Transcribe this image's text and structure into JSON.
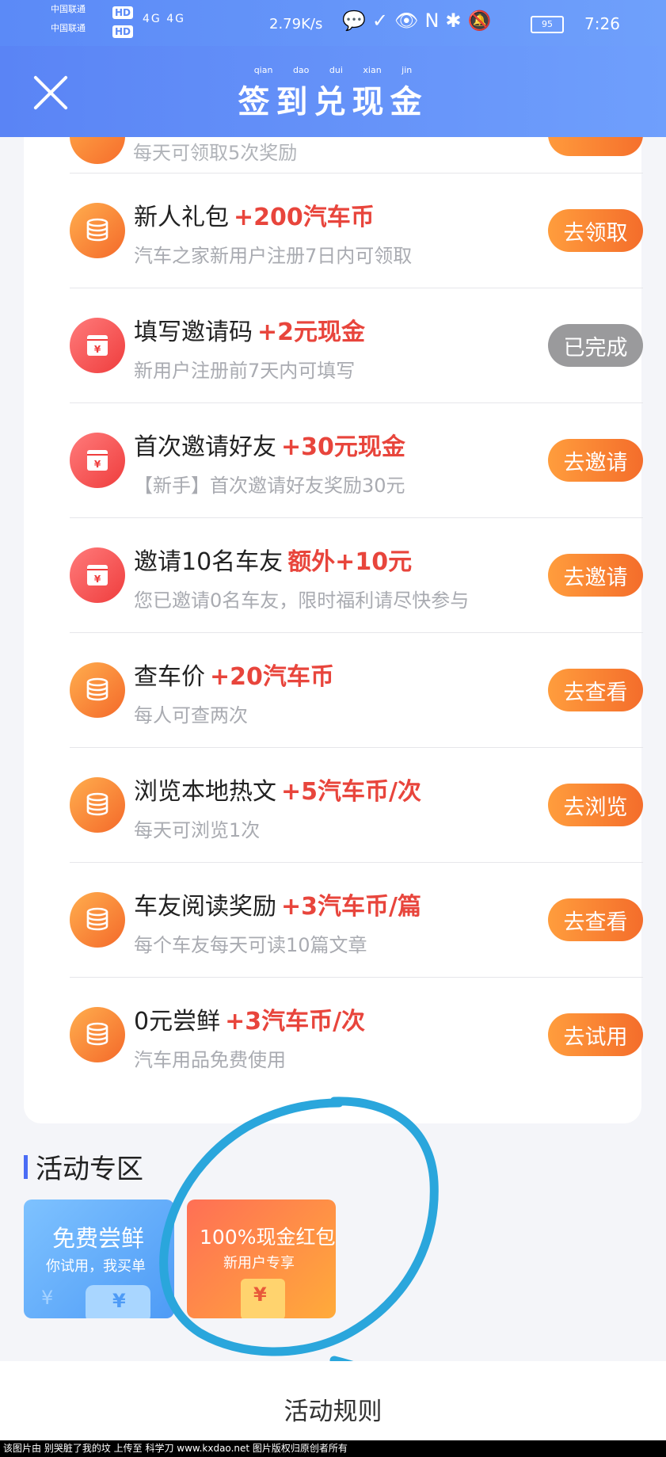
{
  "status_bar": {
    "carrier_line1": "中国联通",
    "carrier_line2": "中国联通",
    "hd": "HD",
    "network": "4G 4G",
    "speed": "2.79K/s",
    "battery": "95",
    "time": "7:26"
  },
  "header": {
    "title": "签到兑现金",
    "pinyin": "qian dao dui xian jin"
  },
  "partial_row": {
    "desc": "每天可领取5次奖励"
  },
  "tasks": [
    {
      "icon": "coin-stack-icon",
      "name": "新人礼包",
      "reward": "+200汽车币",
      "desc": "汽车之家新用户注册7日内可领取",
      "button": "去领取",
      "done": false
    },
    {
      "icon": "red-envelope-icon",
      "name": "填写邀请码",
      "reward": "+2元现金",
      "desc": "新用户注册前7天内可填写",
      "button": "已完成",
      "done": true
    },
    {
      "icon": "red-envelope-icon",
      "name": "首次邀请好友",
      "reward": "+30元现金",
      "desc": "【新手】首次邀请好友奖励30元",
      "button": "去邀请",
      "done": false
    },
    {
      "icon": "red-envelope-icon",
      "name": "邀请10名车友",
      "reward": "额外+10元",
      "desc": "您已邀请0名车友，限时福利请尽快参与",
      "button": "去邀请",
      "done": false
    },
    {
      "icon": "coin-stack-icon",
      "name": "查车价",
      "reward": "+20汽车币",
      "desc": "每人可查两次",
      "button": "去查看",
      "done": false
    },
    {
      "icon": "coin-stack-icon",
      "name": "浏览本地热文",
      "reward": "+5汽车币/次",
      "desc": "每天可浏览1次",
      "button": "去浏览",
      "done": false
    },
    {
      "icon": "coin-stack-icon",
      "name": "车友阅读奖励",
      "reward": "+3汽车币/篇",
      "desc": "每个车友每天可读10篇文章",
      "button": "去查看",
      "done": false
    },
    {
      "icon": "coin-stack-icon",
      "name": "0元尝鲜",
      "reward": "+3汽车币/次",
      "desc": "汽车用品免费使用",
      "button": "去试用",
      "done": false
    }
  ],
  "activity": {
    "section_title": "活动专区",
    "banner1_title": "免费尝鲜",
    "banner1_sub": "你试用，我买单",
    "banner2_title": "100%现金红包",
    "banner2_sub": "新用户专享",
    "yen": "¥"
  },
  "footer": {
    "rules": "活动规则"
  },
  "watermark": "该图片由 别哭脏了我的坟 上传至 科学刀 www.kxdao.net 图片版权归原创者所有",
  "colors": {
    "accent": "#5b8af7",
    "reward": "#e8453c",
    "button": "#f5722c",
    "done": "#9a9a9c",
    "annotation": "#2aa6dc"
  }
}
